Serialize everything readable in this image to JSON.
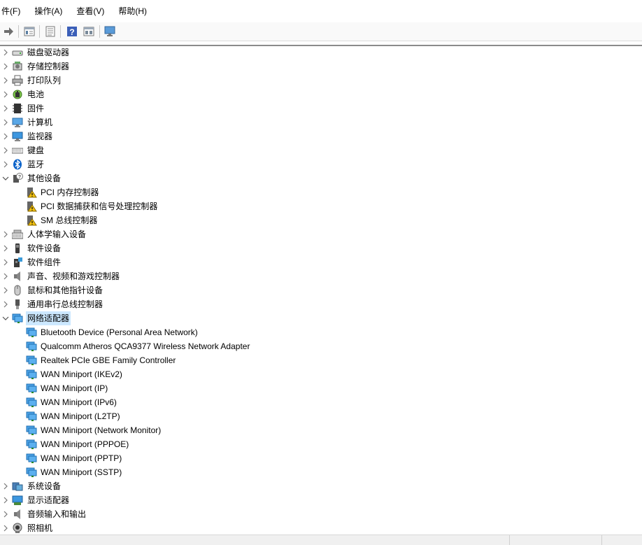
{
  "menubar": {
    "items": [
      {
        "label": "件(F)"
      },
      {
        "label": "操作(A)"
      },
      {
        "label": "查看(V)"
      },
      {
        "label": "帮助(H)"
      }
    ]
  },
  "toolbar": {
    "buttons": [
      "forward-icon",
      "properties-icon",
      "details-icon",
      "help-icon",
      "view-icon",
      "monitor-icon"
    ]
  },
  "tree": {
    "categories": [
      {
        "label": "磁盘驱动器",
        "icon": "disk-drive-icon",
        "expanded": false
      },
      {
        "label": "存储控制器",
        "icon": "storage-controller-icon",
        "expanded": false
      },
      {
        "label": "打印队列",
        "icon": "printer-icon",
        "expanded": false
      },
      {
        "label": "电池",
        "icon": "battery-icon",
        "expanded": false
      },
      {
        "label": "固件",
        "icon": "firmware-icon",
        "expanded": false
      },
      {
        "label": "计算机",
        "icon": "computer-icon",
        "expanded": false
      },
      {
        "label": "监视器",
        "icon": "monitor-icon",
        "expanded": false
      },
      {
        "label": "键盘",
        "icon": "keyboard-icon",
        "expanded": false
      },
      {
        "label": "蓝牙",
        "icon": "bluetooth-icon",
        "expanded": false
      },
      {
        "label": "其他设备",
        "icon": "unknown-device-icon",
        "expanded": true,
        "children": [
          {
            "label": "PCI 内存控制器",
            "icon": "warning-device-icon"
          },
          {
            "label": "PCI 数据捕获和信号处理控制器",
            "icon": "warning-device-icon"
          },
          {
            "label": "SM 总线控制器",
            "icon": "warning-device-icon"
          }
        ]
      },
      {
        "label": "人体学输入设备",
        "icon": "hid-icon",
        "expanded": false
      },
      {
        "label": "软件设备",
        "icon": "software-device-icon",
        "expanded": false
      },
      {
        "label": "软件组件",
        "icon": "software-component-icon",
        "expanded": false
      },
      {
        "label": "声音、视频和游戏控制器",
        "icon": "speaker-icon",
        "expanded": false
      },
      {
        "label": "鼠标和其他指针设备",
        "icon": "mouse-icon",
        "expanded": false
      },
      {
        "label": "通用串行总线控制器",
        "icon": "usb-icon",
        "expanded": false
      },
      {
        "label": "网络适配器",
        "icon": "network-adapter-icon",
        "expanded": true,
        "selected": true,
        "children": [
          {
            "label": "Bluetooth Device (Personal Area Network)",
            "icon": "network-adapter-icon"
          },
          {
            "label": "Qualcomm Atheros QCA9377 Wireless Network Adapter",
            "icon": "network-adapter-icon"
          },
          {
            "label": "Realtek PCIe GBE Family Controller",
            "icon": "network-adapter-icon"
          },
          {
            "label": "WAN Miniport (IKEv2)",
            "icon": "network-adapter-icon"
          },
          {
            "label": "WAN Miniport (IP)",
            "icon": "network-adapter-icon"
          },
          {
            "label": "WAN Miniport (IPv6)",
            "icon": "network-adapter-icon"
          },
          {
            "label": "WAN Miniport (L2TP)",
            "icon": "network-adapter-icon"
          },
          {
            "label": "WAN Miniport (Network Monitor)",
            "icon": "network-adapter-icon"
          },
          {
            "label": "WAN Miniport (PPPOE)",
            "icon": "network-adapter-icon"
          },
          {
            "label": "WAN Miniport (PPTP)",
            "icon": "network-adapter-icon"
          },
          {
            "label": "WAN Miniport (SSTP)",
            "icon": "network-adapter-icon"
          }
        ]
      },
      {
        "label": "系统设备",
        "icon": "system-device-icon",
        "expanded": false
      },
      {
        "label": "显示适配器",
        "icon": "display-adapter-icon",
        "expanded": false
      },
      {
        "label": "音频输入和输出",
        "icon": "audio-io-icon",
        "expanded": false
      },
      {
        "label": "照相机",
        "icon": "camera-icon",
        "expanded": false
      }
    ]
  },
  "colors": {
    "selection": "#cce8ff",
    "warning": "#f2c10f",
    "network": "#2a8ad4"
  }
}
